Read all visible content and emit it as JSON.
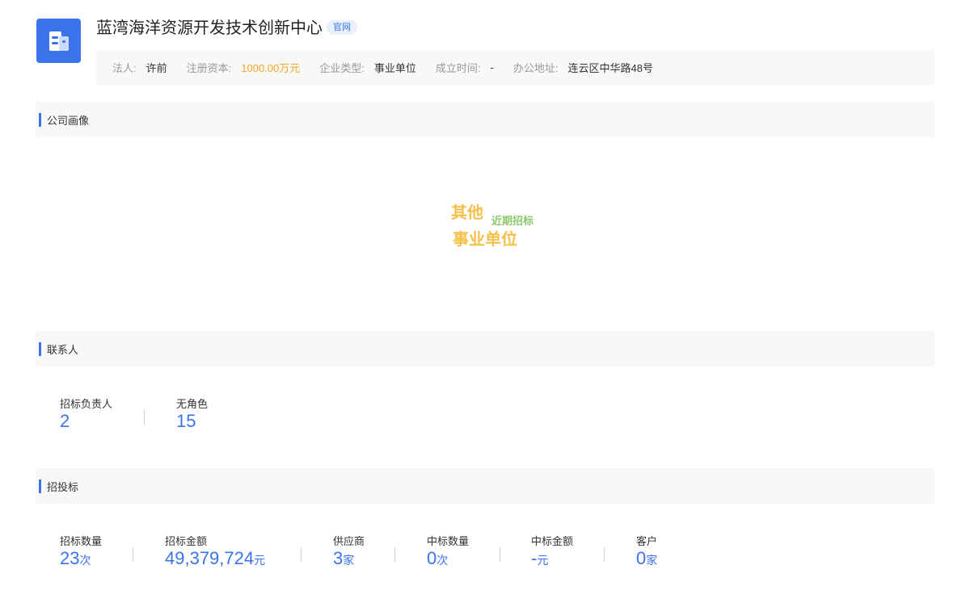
{
  "company": {
    "name": "蓝湾海洋资源开发技术创新中心",
    "official_site_tag": "官网",
    "brand_color": "#3a73ea",
    "logo_icon": "building-icon"
  },
  "info": {
    "legal_person_label": "法人:",
    "legal_person_value": "许前",
    "capital_label": "注册资本:",
    "capital_value": "1000.00万元",
    "type_label": "企业类型:",
    "type_value": "事业单位",
    "founded_label": "成立时间:",
    "founded_value": "-",
    "address_label": "办公地址:",
    "address_value": "连云区中华路48号"
  },
  "portrait": {
    "title": "公司画像",
    "words": [
      {
        "text": "其他",
        "color": "#f5c04a"
      },
      {
        "text": "近期招标",
        "color": "#8cc96e"
      },
      {
        "text": "事业单位",
        "color": "#f5c04a"
      }
    ]
  },
  "contacts": {
    "title": "联系人",
    "stats": [
      {
        "label": "招标负责人",
        "value": "2"
      },
      {
        "label": "无角色",
        "value": "15"
      }
    ]
  },
  "bidding": {
    "title": "招投标",
    "stats": [
      {
        "label": "招标数量",
        "value": "23",
        "unit": "次"
      },
      {
        "label": "招标金额",
        "value": "49,379,724",
        "unit": "元"
      },
      {
        "label": "供应商",
        "value": "3",
        "unit": "家"
      },
      {
        "label": "中标数量",
        "value": "0",
        "unit": "次"
      },
      {
        "label": "中标金额",
        "value": "-",
        "unit": "元"
      },
      {
        "label": "客户",
        "value": "0",
        "unit": "家"
      }
    ]
  }
}
